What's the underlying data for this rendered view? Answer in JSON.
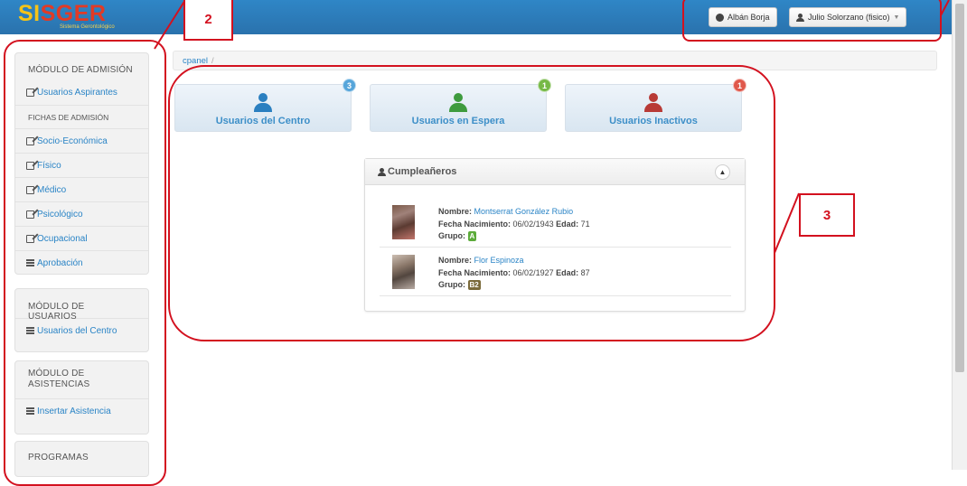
{
  "app": {
    "logo_text_a": "SI",
    "logo_text_b": "SGER",
    "logo_subtitle": "Sistema Gerontológico"
  },
  "header": {
    "link_label": "Albán Borja",
    "user_label": "Julio Solorzano (fisico)"
  },
  "breadcrumb": {
    "home": "cpanel",
    "sep": "/"
  },
  "sidebar": {
    "admision": {
      "title": "MÓDULO DE ADMISIÓN",
      "first_item": "Usuarios Aspirantes",
      "subtitle": "FICHAS DE ADMISIÓN",
      "items": [
        "Socio-Económica",
        "Físico",
        "Médico",
        "Psicológico",
        "Ocupacional",
        "Aprobación"
      ]
    },
    "usuarios": {
      "title": "MÓDULO DE USUARIOS",
      "items": [
        "Usuarios del Centro"
      ]
    },
    "asistencias": {
      "title_line1": "MÓDULO DE",
      "title_line2": "ASISTENCIAS",
      "items": [
        "Insertar Asistencia"
      ]
    },
    "programas": {
      "title": "PROGRAMAS"
    }
  },
  "cards": [
    {
      "label": "Usuarios del Centro",
      "badge": "3",
      "icon_color": "#2a7fc0",
      "badge_color": "#56a5da"
    },
    {
      "label": "Usuarios en Espera",
      "badge": "1",
      "icon_color": "#3e9b3e",
      "badge_color": "#76b947"
    },
    {
      "label": "Usuarios Inactivos",
      "badge": "1",
      "icon_color": "#b83a36",
      "badge_color": "#e0584b"
    }
  ],
  "birthdays": {
    "title": "Cumpleañeros",
    "labels": {
      "name": "Nombre:",
      "dob": "Fecha Nacimiento:",
      "age": "Edad:",
      "group": "Grupo:"
    },
    "people": [
      {
        "name": "Montserrat González Rubio",
        "dob": "06/02/1943",
        "age": "71",
        "group": "A",
        "group_color": "#5cab3a"
      },
      {
        "name": "Flor Espinoza",
        "dob": "06/02/1927",
        "age": "87",
        "group": "B2",
        "group_color": "#7a6a3a"
      }
    ]
  },
  "annotations": {
    "label_2": "2",
    "label_3": "3"
  }
}
